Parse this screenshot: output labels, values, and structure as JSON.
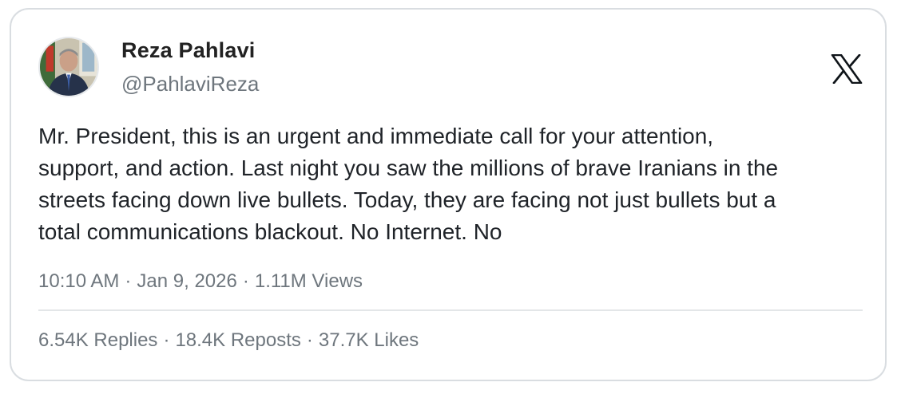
{
  "author": {
    "display_name": "Reza Pahlavi",
    "handle": "@PahlaviReza",
    "avatar_icon": "profile-photo"
  },
  "brand": {
    "logo_icon": "x-logo-icon"
  },
  "tweet": {
    "text": "Mr. President, this is an urgent and immediate call for your attention,\nsupport, and action. Last night you saw the millions of brave Iranians in the\nstreets facing down live bullets. Today, they are facing not just bullets but a\ntotal communications blackout. No Internet. No"
  },
  "meta": {
    "time": "10:10 AM",
    "date": "Jan 9, 2026",
    "views": "1.11M Views",
    "separator": "·"
  },
  "stats": {
    "replies": "6.54K Replies",
    "reposts": "18.4K Reposts",
    "likes": "37.7K Likes"
  },
  "colors": {
    "border": "#d9dde1",
    "muted_text": "#6e767d",
    "body_text": "#1f2328"
  }
}
